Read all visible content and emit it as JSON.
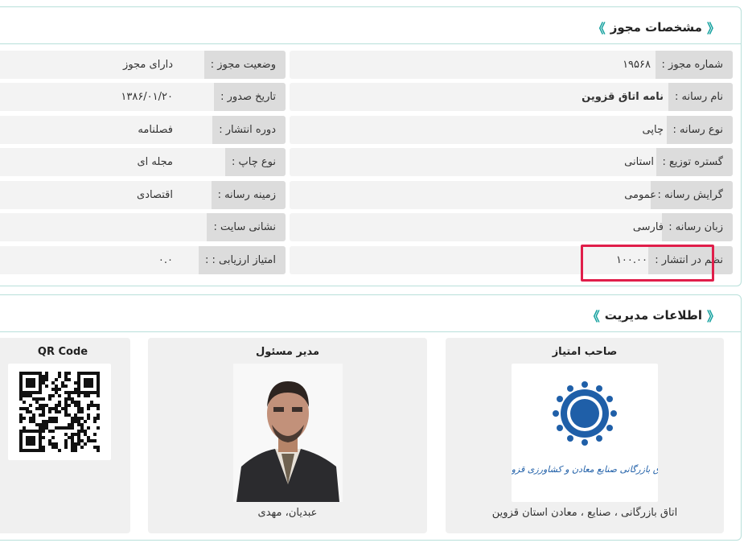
{
  "license_section": {
    "title": "مشخصات مجوز",
    "right_column": [
      {
        "label": "شماره مجوز :",
        "value": "۱۹۵۶۸",
        "bold": false
      },
      {
        "label": "نام رسانه :",
        "value": "نامه اتاق قزوین",
        "bold": true
      },
      {
        "label": "نوع رسانه :",
        "value": "چاپی",
        "bold": false
      },
      {
        "label": "گستره توزیع :",
        "value": "استانی",
        "bold": false
      },
      {
        "label": "گرایش رسانه :",
        "value": "عمومی",
        "bold": false
      },
      {
        "label": "زبان رسانه :",
        "value": "فارسی",
        "bold": false
      },
      {
        "label": "نظم در انتشار :",
        "value": "۱۰۰.۰۰",
        "bold": false
      }
    ],
    "left_column": [
      {
        "label": "وضعیت مجوز :",
        "value": "دارای مجوز"
      },
      {
        "label": "تاریخ صدور :",
        "value": "۱۳۸۶/۰۱/۲۰"
      },
      {
        "label": "دوره انتشار :",
        "value": "فصلنامه"
      },
      {
        "label": "نوع چاپ :",
        "value": "مجله ای"
      },
      {
        "label": "زمینه رسانه :",
        "value": "اقتصادی"
      },
      {
        "label": "نشانی سایت :",
        "value": ""
      },
      {
        "label": "امتیاز ارزیابی : :",
        "value": "۰.۰"
      }
    ]
  },
  "management_section": {
    "title": "اطلاعات مدیریت",
    "owner": {
      "title": "صاحب امتیاز",
      "caption": "اتاق بازرگانی ، صنایع ، معادن استان قزوین",
      "logo_text": "اتاق بازرگانی صنایع معادن و کشاورزی قزوین"
    },
    "manager": {
      "title": "مدیر مسئول",
      "caption": "عبدیان، مهدی"
    },
    "qr": {
      "title": "QR Code"
    }
  },
  "colors": {
    "accent": "#17a2a0",
    "highlight": "#e01e4a",
    "label_bg": "#dcdcdc",
    "field_bg": "#f3f3f3"
  }
}
